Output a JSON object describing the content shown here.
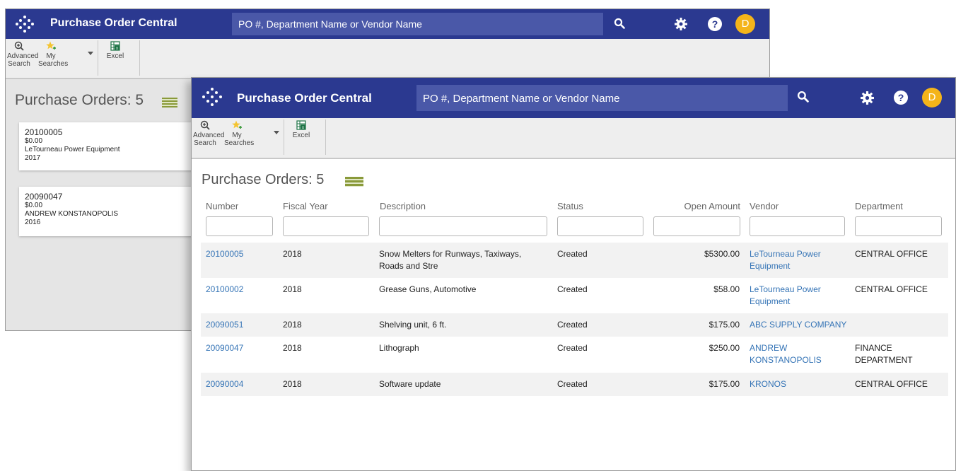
{
  "app": {
    "title": "Purchase Order Central",
    "search_placeholder": "PO #, Department Name or Vendor Name",
    "avatar_initial": "D",
    "help_glyph": "?"
  },
  "toolbar": {
    "advanced_search": "Advanced Search",
    "my_searches": "My Searches",
    "excel": "Excel"
  },
  "back_window": {
    "heading": "Purchase Orders: 5",
    "cards": [
      {
        "number": "20100005",
        "amount": "$0.00",
        "vendor": "LeTourneau Power Equipment",
        "year": "2017"
      },
      {
        "number": "20090047",
        "amount": "$0.00",
        "vendor": "ANDREW KONSTANOPOLIS",
        "year": "2016"
      }
    ]
  },
  "front_window": {
    "heading": "Purchase Orders: 5",
    "columns": [
      "Number",
      "Fiscal Year",
      "Description",
      "Status",
      "Open Amount",
      "Vendor",
      "Department"
    ],
    "rows": [
      {
        "number": "20100005",
        "year": "2018",
        "description": "Snow Melters for Runways, Taxiways, Roads and Stre",
        "status": "Created",
        "amount": "$5300.00",
        "vendor": "LeTourneau Power Equipment",
        "department": "CENTRAL OFFICE"
      },
      {
        "number": "20100002",
        "year": "2018",
        "description": "Grease Guns, Automotive",
        "status": "Created",
        "amount": "$58.00",
        "vendor": "LeTourneau Power Equipment",
        "department": "CENTRAL OFFICE"
      },
      {
        "number": "20090051",
        "year": "2018",
        "description": "Shelving unit, 6 ft.",
        "status": "Created",
        "amount": "$175.00",
        "vendor": "ABC SUPPLY COMPANY",
        "department": ""
      },
      {
        "number": "20090047",
        "year": "2018",
        "description": "Lithograph",
        "status": "Created",
        "amount": "$250.00",
        "vendor": "ANDREW KONSTANOPOLIS",
        "department": "FINANCE DEPARTMENT"
      },
      {
        "number": "20090004",
        "year": "2018",
        "description": "Software update",
        "status": "Created",
        "amount": "$175.00",
        "vendor": "KRONOS",
        "department": "CENTRAL OFFICE"
      }
    ]
  },
  "icons": {
    "logo": "logo-icon",
    "search": "search-icon",
    "settings": "gear-icon",
    "help": "help-icon",
    "advanced_search": "magnifier-plus-icon",
    "my_searches": "star-plus-icon",
    "excel": "excel-icon",
    "list_view": "list-view-icon"
  },
  "colors": {
    "header": "#2b3990",
    "search_field": "#4a58a8",
    "avatar": "#f4b41a",
    "link": "#3574b6",
    "list_icon": "#8a9a3a"
  }
}
